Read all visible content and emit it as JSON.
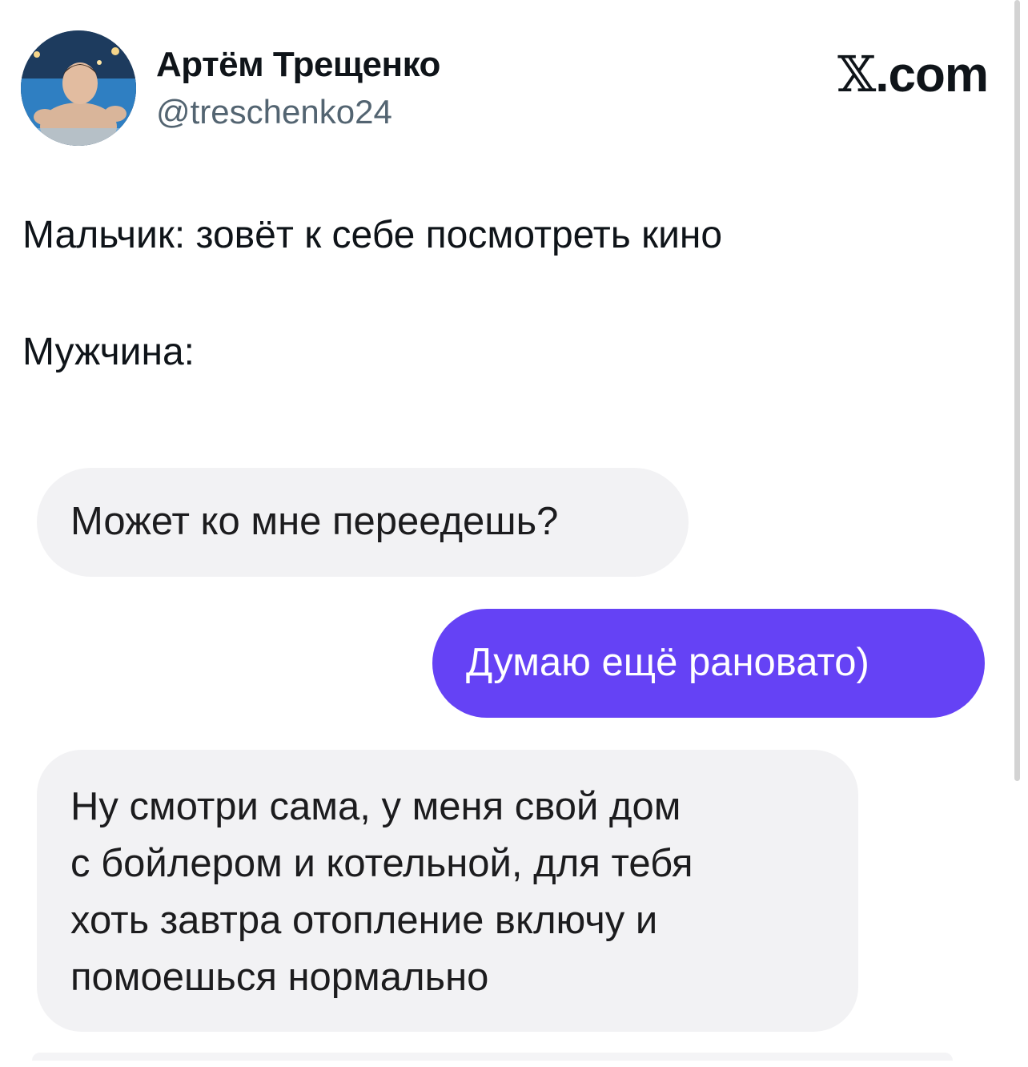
{
  "author": {
    "name": "Артём Трещенко",
    "handle": "@treschenko24",
    "avatar_icon": "profile-photo"
  },
  "brand": {
    "x_glyph": "𝕏",
    "domain": ".com"
  },
  "tweet": {
    "lines": [
      "Мальчик: зовёт к себе посмотреть кино",
      "Мужчина:"
    ]
  },
  "chat": {
    "incoming_color": "#f2f2f4",
    "outgoing_color": "#6542f5",
    "messages": [
      {
        "side": "incoming",
        "lines": [
          "Может ко мне переедешь?"
        ]
      },
      {
        "side": "outgoing",
        "lines": [
          "Думаю ещё рановато)"
        ]
      },
      {
        "side": "incoming",
        "lines": [
          "Ну смотри сама, у меня свой дом",
          "с бойлером и котельной, для тебя",
          "хоть завтра отопление включу и",
          "помоешься нормально"
        ]
      }
    ]
  }
}
